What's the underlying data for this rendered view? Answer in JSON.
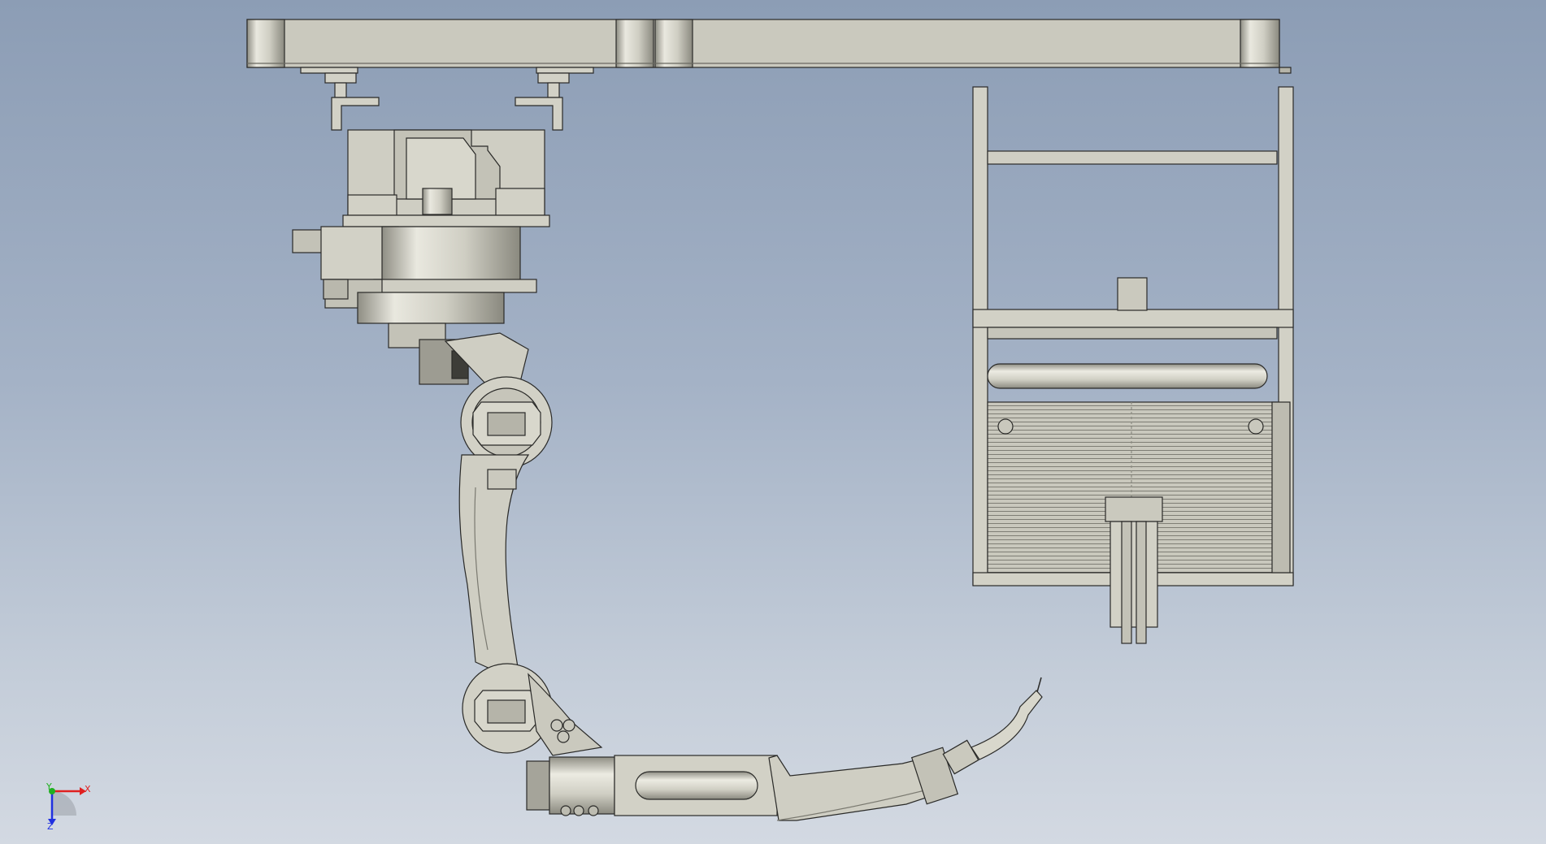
{
  "viewport": {
    "background_top": "#8c9db5",
    "background_bottom": "#d3d9e2"
  },
  "model": {
    "part_fill": "#d2d1c6",
    "part_shade": "#a9a89c",
    "edge_color": "#2a2a28",
    "components": [
      "overhead-gantry-beam",
      "robot-base-mount",
      "robot-turntable",
      "robot-upper-arm",
      "robot-forearm",
      "welding-torch",
      "wire-feeder-frame"
    ]
  },
  "triad": {
    "x_label": "X",
    "y_label": "Y",
    "z_label": "Z",
    "x_color": "#e02020",
    "y_color": "#20b020",
    "z_color": "#2030e0"
  }
}
